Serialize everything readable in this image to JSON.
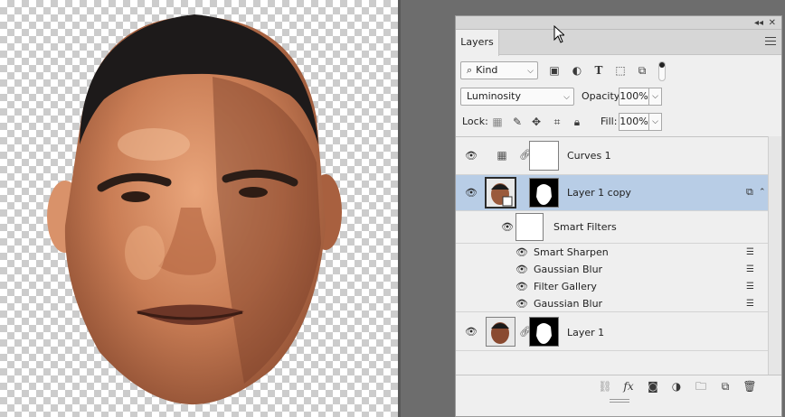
{
  "panel": {
    "tab_label": "Layers",
    "collapse_glyph": "◂◂",
    "close_glyph": "✕"
  },
  "filter": {
    "kind_label": "Kind",
    "kind_glyph": "⌕",
    "filter_icons": [
      "pixel-filter-icon",
      "adjustment-filter-icon",
      "type-filter-icon",
      "shape-filter-icon",
      "smartobject-filter-icon"
    ]
  },
  "blend": {
    "mode": "Luminosity",
    "opacity_label": "Opacity:",
    "opacity_value": "100%"
  },
  "lock": {
    "label": "Lock:",
    "fill_label": "Fill:",
    "fill_value": "100%"
  },
  "layers": [
    {
      "name": "Curves 1",
      "type": "adjustment",
      "selected": false
    },
    {
      "name": "Layer 1 copy",
      "type": "smart-object",
      "selected": true
    },
    {
      "name": "Smart Filters",
      "type": "smart-filters-header"
    },
    {
      "name": "Smart Sharpen",
      "type": "filter"
    },
    {
      "name": "Gaussian Blur",
      "type": "filter"
    },
    {
      "name": "Filter Gallery",
      "type": "filter"
    },
    {
      "name": "Gaussian Blur",
      "type": "filter"
    },
    {
      "name": "Layer 1",
      "type": "pixel",
      "selected": false
    }
  ],
  "bottom_icons": [
    "link-layers-icon",
    "fx-icon",
    "add-mask-icon",
    "new-adjustment-icon",
    "new-group-icon",
    "new-layer-icon",
    "delete-layer-icon"
  ],
  "colors": {
    "selected_row": "#b8cde6",
    "panel_bg": "#efefef",
    "workspace_bg": "#6d6d6d"
  }
}
